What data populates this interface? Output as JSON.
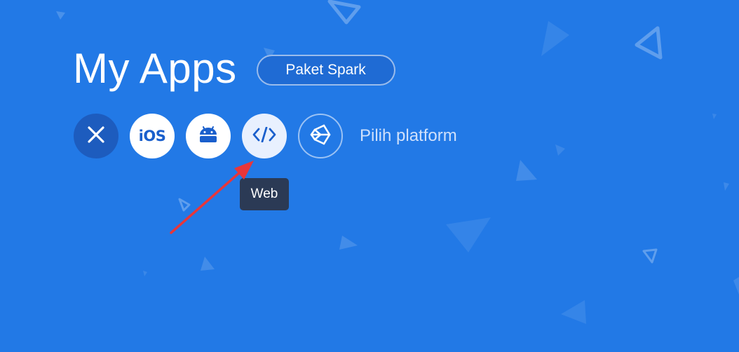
{
  "page": {
    "title": "My Apps",
    "plan_badge": "Paket Spark"
  },
  "platforms": {
    "items": [
      {
        "name": "close",
        "icon": "close-icon"
      },
      {
        "name": "ios",
        "icon": "ios-icon",
        "label": "iOS"
      },
      {
        "name": "android",
        "icon": "android-icon"
      },
      {
        "name": "web",
        "icon": "code-icon"
      },
      {
        "name": "unity",
        "icon": "unity-icon"
      }
    ],
    "pick_label": "Pilih platform"
  },
  "tooltip": {
    "text": "Web"
  },
  "colors": {
    "background": "#2279e6",
    "tooltip": "#2b3a55",
    "annotation_arrow": "#e8363a"
  }
}
